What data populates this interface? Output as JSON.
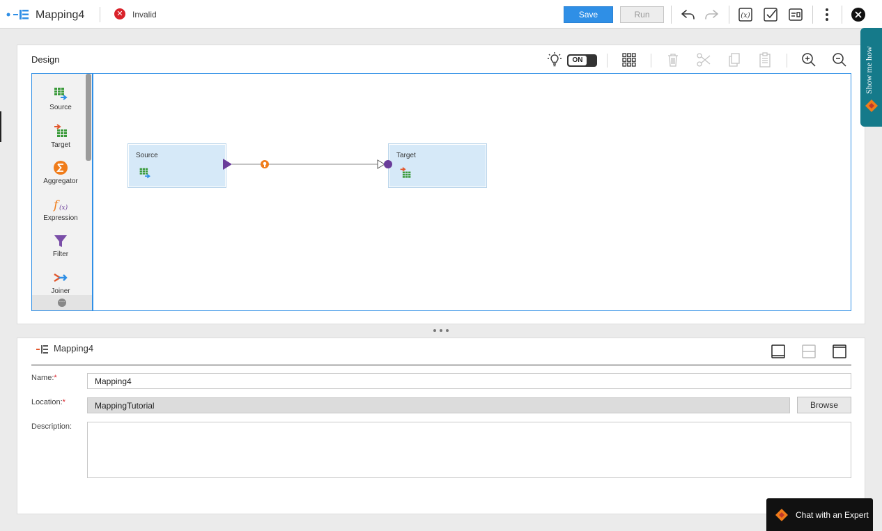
{
  "header": {
    "title": "Mapping4",
    "status": "Invalid",
    "save_label": "Save",
    "run_label": "Run",
    "icons": [
      "undo-icon",
      "redo-icon",
      "parameters-icon",
      "validate-icon",
      "properties-icon",
      "more-icon",
      "close-icon"
    ]
  },
  "design": {
    "title": "Design",
    "toggle_label": "ON",
    "toolbar_icons": [
      "lightbulb-icon",
      "arrange-grid-icon",
      "delete-icon",
      "cut-icon",
      "copy-icon",
      "paste-icon",
      "zoom-in-icon",
      "zoom-out-icon"
    ],
    "palette": [
      {
        "label": "Source",
        "icon": "source-icon"
      },
      {
        "label": "Target",
        "icon": "target-icon"
      },
      {
        "label": "Aggregator",
        "icon": "aggregator-icon"
      },
      {
        "label": "Expression",
        "icon": "expression-icon"
      },
      {
        "label": "Filter",
        "icon": "filter-icon"
      },
      {
        "label": "Joiner",
        "icon": "joiner-icon"
      }
    ],
    "nodes": [
      {
        "label": "Source"
      },
      {
        "label": "Target"
      }
    ]
  },
  "properties": {
    "title": "Mapping4",
    "name_label": "Name:",
    "name_value": "Mapping4",
    "location_label": "Location:",
    "location_value": "MappingTutorial",
    "browse_label": "Browse",
    "description_label": "Description:",
    "description_value": "",
    "required_marker": "*"
  },
  "side_tab": {
    "label": "Show me how"
  },
  "chat": {
    "label": "Chat with an Expert"
  },
  "colors": {
    "accent": "#2f8fe6",
    "error": "#d9222a",
    "node_fill": "#d6e9f8",
    "link_purple": "#6a3d9a",
    "side_tab": "#157a8a"
  }
}
